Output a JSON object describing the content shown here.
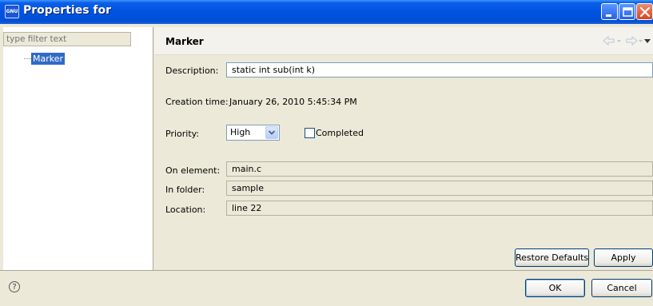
{
  "window": {
    "title": "Properties for",
    "icon_label": "GNU",
    "controls": [
      "minimize-icon",
      "maximize-icon",
      "close-icon"
    ]
  },
  "sidebar": {
    "filter_placeholder": "type filter text",
    "items": [
      {
        "label": "Marker",
        "selected": true
      }
    ]
  },
  "page": {
    "title": "Marker",
    "nav_icons": [
      "back-arrow-icon",
      "forward-arrow-icon",
      "view-menu-icon"
    ]
  },
  "form": {
    "description": {
      "label": "Description:",
      "value": "static int sub(int k)"
    },
    "creation_time": {
      "label": "Creation time:",
      "value": "January 26, 2010 5:45:34 PM"
    },
    "priority": {
      "label": "Priority:",
      "value": "High"
    },
    "completed": {
      "label": "Completed",
      "checked": false
    },
    "on_element": {
      "label": "On element:",
      "value": "main.c"
    },
    "in_folder": {
      "label": "In folder:",
      "value": "sample"
    },
    "location": {
      "label": "Location:",
      "value": "line 22"
    }
  },
  "buttons": {
    "restore_defaults": "Restore Defaults",
    "apply": "Apply",
    "ok": "OK",
    "cancel": "Cancel",
    "help_symbol": "?"
  },
  "colors": {
    "titlebar": "#0053e0",
    "selection": "#316ac5",
    "dialog_bg": "#ece9d8"
  }
}
